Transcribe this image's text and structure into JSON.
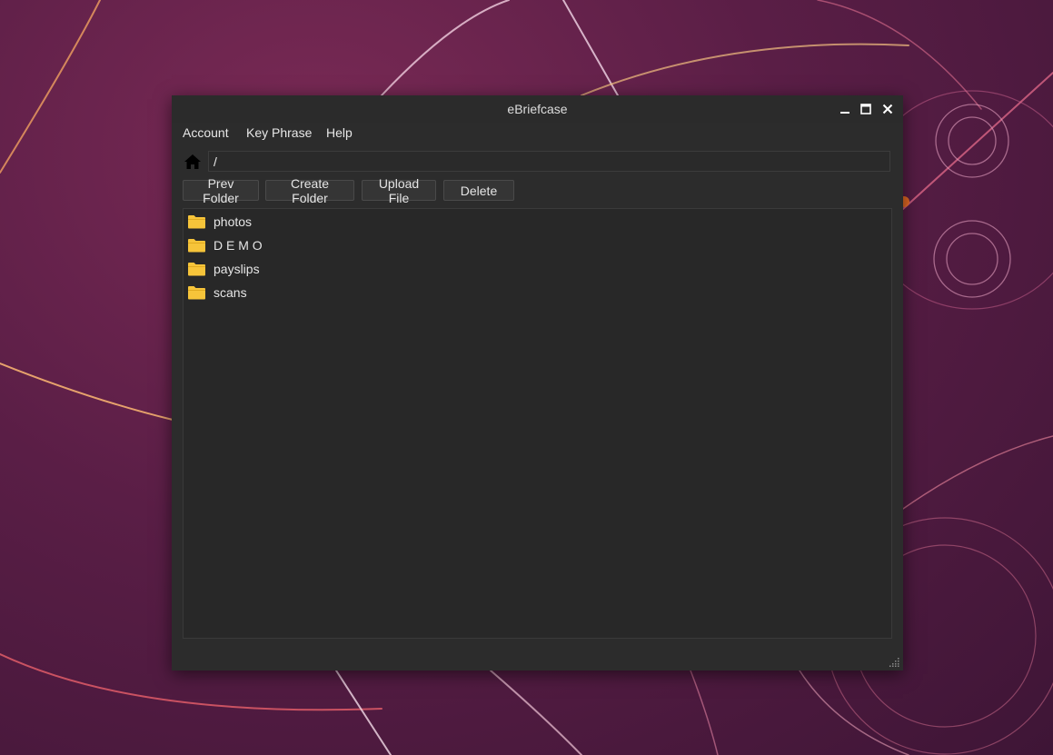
{
  "window": {
    "title": "eBriefcase",
    "controls": [
      "minimize-icon",
      "maximize-icon",
      "close-icon"
    ]
  },
  "menubar": {
    "items": [
      {
        "label": "Account"
      },
      {
        "label": "Key Phrase"
      },
      {
        "label": "Help"
      }
    ]
  },
  "path": {
    "icon": "home-icon",
    "value": "/"
  },
  "toolbar": {
    "prev_folder": "Prev Folder",
    "create_folder": "Create Folder",
    "upload_file": "Upload File",
    "delete": "Delete"
  },
  "files": [
    {
      "name": "photos",
      "icon": "folder-icon"
    },
    {
      "name": "D E M O",
      "icon": "folder-icon"
    },
    {
      "name": "payslips",
      "icon": "folder-icon"
    },
    {
      "name": "scans",
      "icon": "folder-icon"
    }
  ],
  "colors": {
    "window_bg": "#2c2c2c",
    "folder": "#f6c43a",
    "wallpaper": "#5a1e46"
  }
}
